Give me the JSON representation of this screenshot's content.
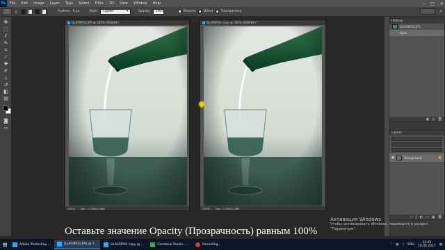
{
  "app": {
    "logo_text": "Ps",
    "menu": [
      "File",
      "Edit",
      "Image",
      "Layer",
      "Type",
      "Select",
      "Filter",
      "3D",
      "View",
      "Window",
      "Help"
    ],
    "window_controls": [
      "–",
      "□",
      "✕"
    ]
  },
  "options_bar": {
    "tool_preset_icon": "marquee-icon",
    "feather_label": "Feather:",
    "feather_value": "0 px",
    "style_label": "Style:",
    "style_value": "Lighter",
    "opacity_label": "Opacity:",
    "opacity_value": "100%",
    "checks": [
      {
        "label": "Reverse",
        "checked": false
      },
      {
        "label": "Dither",
        "checked": true
      },
      {
        "label": "Transparency",
        "checked": true
      }
    ],
    "search_icon": "search-icon"
  },
  "documents": [
    {
      "tab": "GLASSPOU.JPG @ 100% (RGB/8#)",
      "zoom": "100%",
      "doc_size": "Doc: 1.02M/1.08M"
    },
    {
      "tab": "GLASSPOU copy @ 100% (RGB/8#) *",
      "zoom": "100%",
      "doc_size": "Doc: 1.02M/1.08M"
    }
  ],
  "history_panel": {
    "title": "History",
    "snapshot": "GLASSPOU.JPG",
    "items": [
      "Open"
    ]
  },
  "layers_panel": {
    "title": "Layers",
    "layer": {
      "name": "Background",
      "visible": true,
      "locked": true
    }
  },
  "caption": "Оставьте значение Opacity (Прозрачность) равным 100%",
  "watermark": {
    "line1": "Активация Windows",
    "line2": "Чтобы активировать Windows, перейдите в раздел \"Параметры\"."
  },
  "taskbar": {
    "items": [
      {
        "label": "Adobe Photoshop ...",
        "color": "#31a8ff",
        "active": false
      },
      {
        "label": "GLASSPOU.JPG @ 1...",
        "color": "#31a8ff",
        "active": true
      },
      {
        "label": "GLASSPOU copy @ ...",
        "color": "#31a8ff",
        "active": false
      },
      {
        "label": "Camtasia Studio - ...",
        "color": "#3fa34d",
        "active": false
      },
      {
        "label": "Recording...",
        "color": "#d23b2f",
        "active": false
      }
    ],
    "tray_lang": "ENG",
    "time": "12:03",
    "date": "16.05.2017"
  }
}
